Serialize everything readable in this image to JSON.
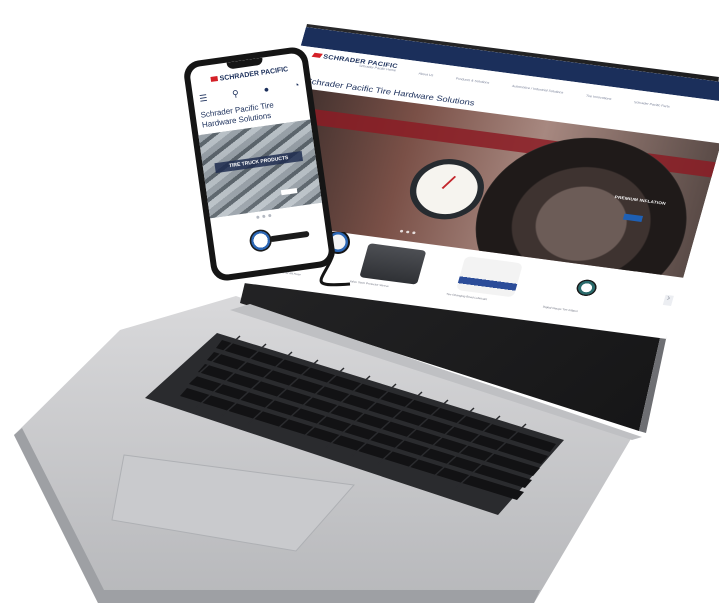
{
  "laptop_site": {
    "brand": "SCHRADER PACIFIC",
    "menu": [
      "Schrader Pacific Home",
      "About Us",
      "Products & Solutions",
      "Automotive / Industrial Solutions",
      "Tire Innovations",
      "Schrader Pacific Parts"
    ],
    "title": "Schrader Pacific Tire Hardware Solutions",
    "hero_caption": "PREMIUM INFLATION",
    "products": [
      {
        "label": "Dial Gauge Tire Inflator w/ 6ft Hose"
      },
      {
        "label": "Valve Stem Protector Sleeve"
      },
      {
        "label": "Tire Changing Bead Lubricant"
      },
      {
        "label": "Digital Gauge Tire Inflator"
      }
    ]
  },
  "phone_site": {
    "brand": "SCHRADER PACIFIC",
    "title": "Schrader Pacific Tire Hardware Solutions",
    "hero_caption": "TIRE TRUCK PRODUCTS",
    "icons": [
      "menu-icon",
      "search-icon",
      "user-icon",
      "cart-icon"
    ]
  },
  "colors": {
    "brand_navy": "#1b2f5b",
    "brand_red": "#d42027",
    "accent_blue": "#1e60b5"
  }
}
